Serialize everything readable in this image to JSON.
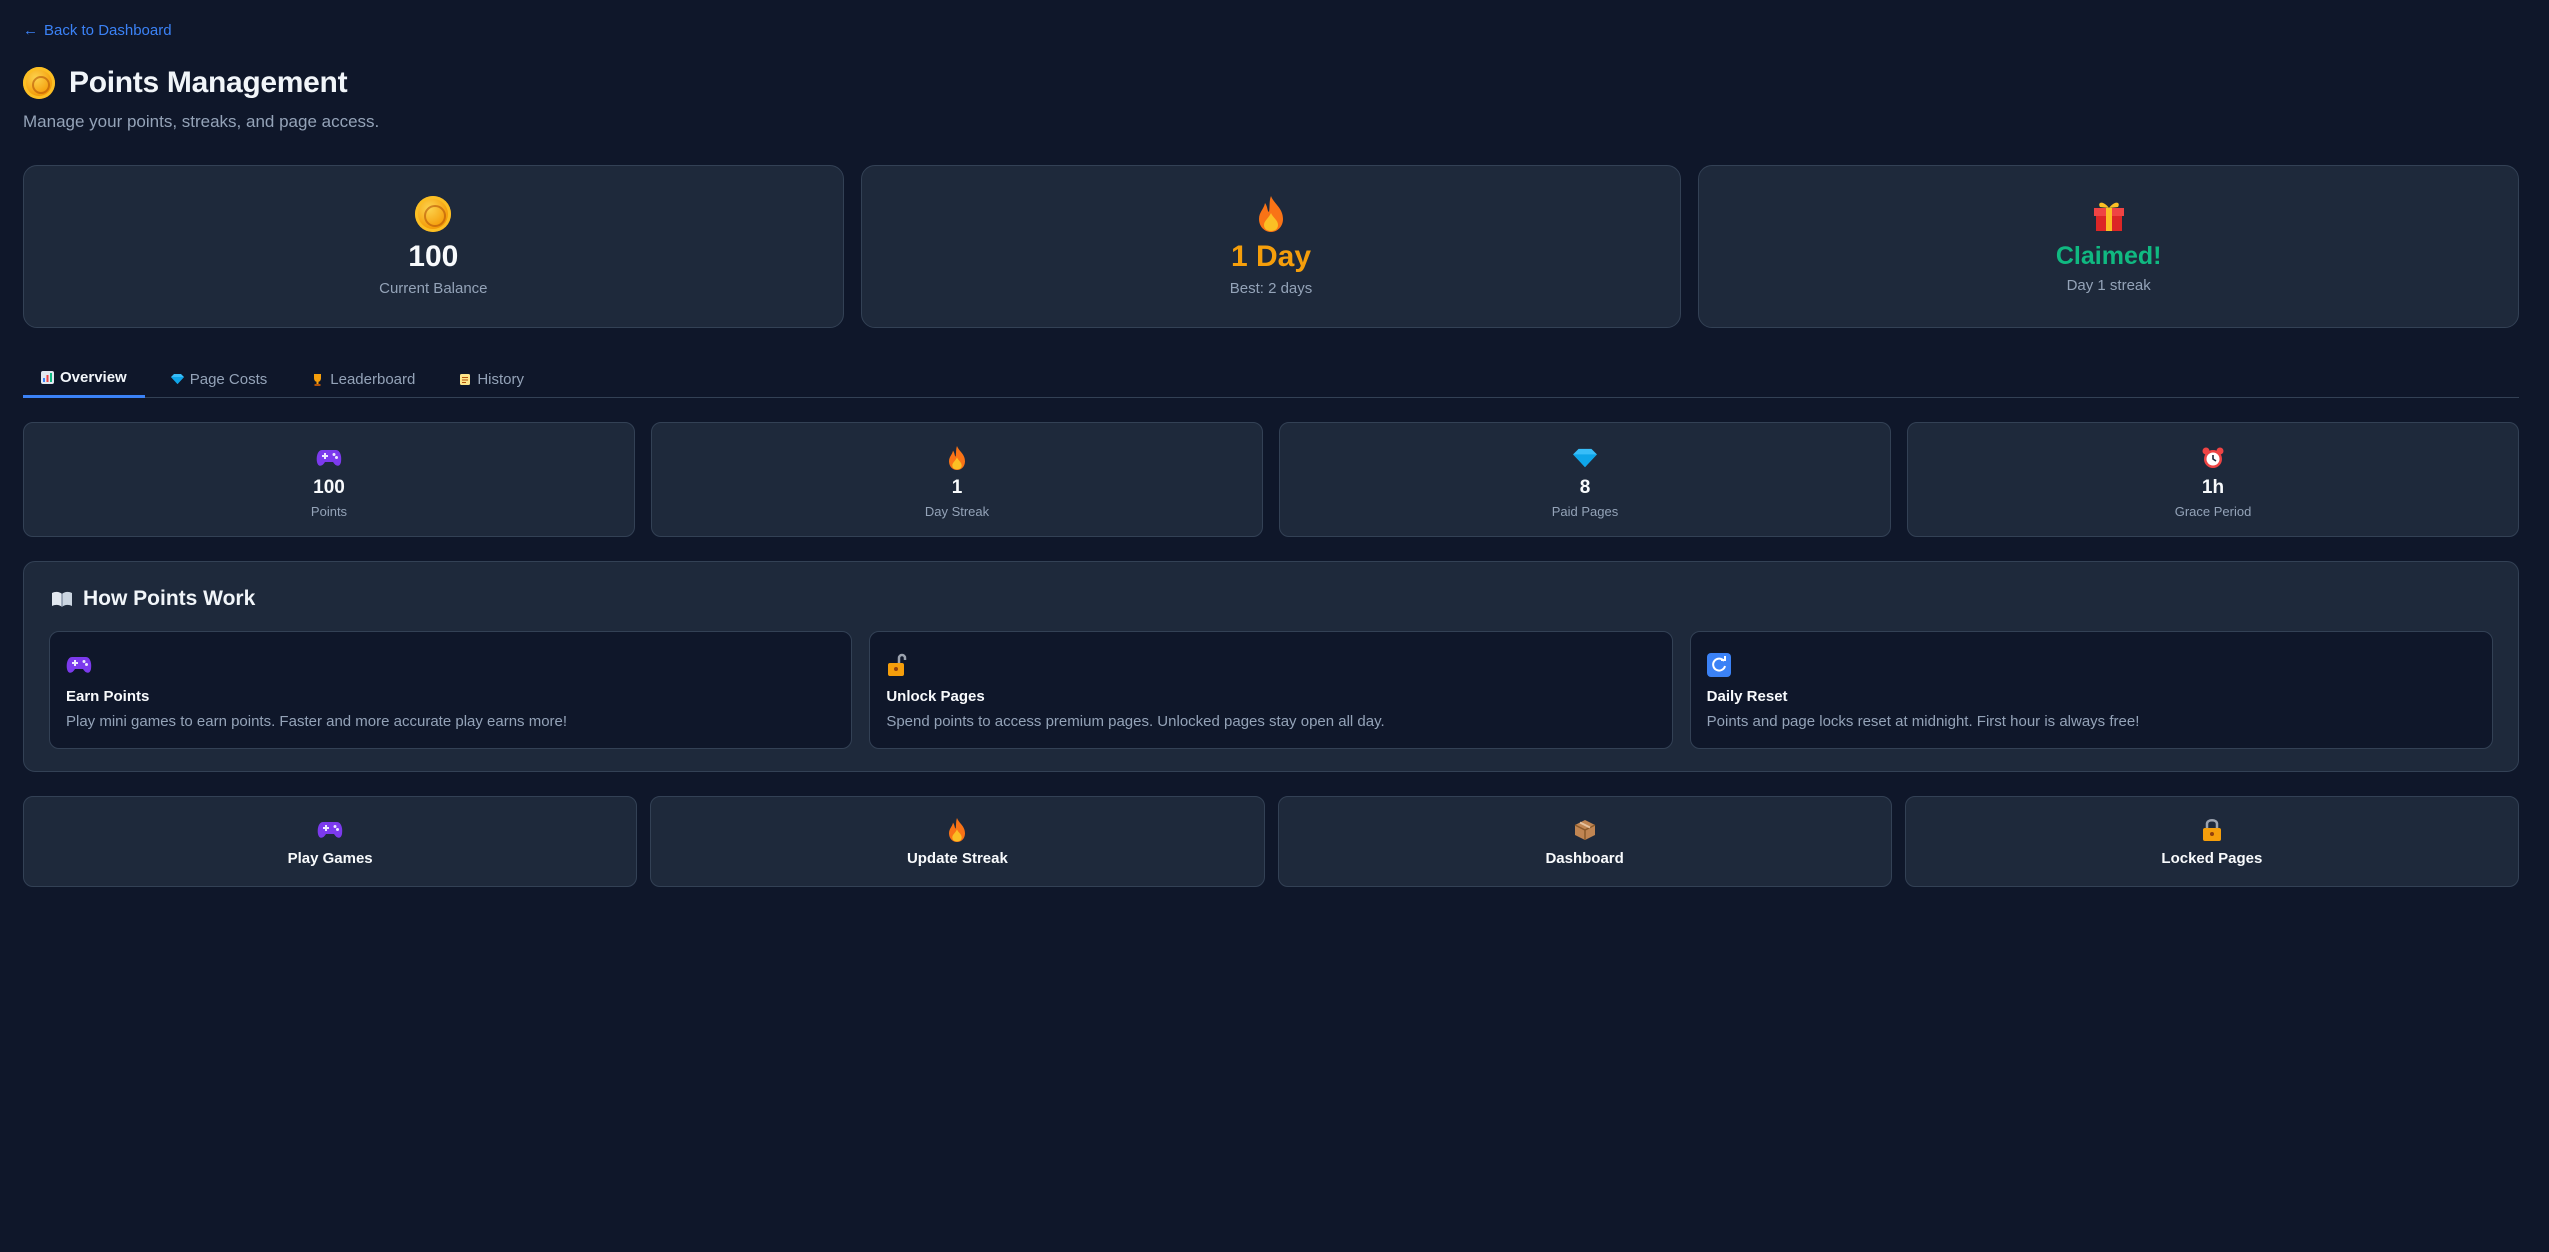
{
  "nav": {
    "back_label": "Back to Dashboard",
    "back_icon": "arrow-left-icon"
  },
  "header": {
    "title": "Points Management",
    "subtitle": "Manage your points, streaks, and page access.",
    "icon": "coin-icon"
  },
  "stats": [
    {
      "icon": "coin-icon",
      "value": "100",
      "label": "Current Balance",
      "color": "#f8fafc"
    },
    {
      "icon": "fire-icon",
      "value": "1 Day",
      "label": "Best: 2 days",
      "color": "#f59e0b"
    },
    {
      "icon": "gift-icon",
      "value": "Claimed!",
      "label": "Day 1 streak",
      "color": "#10b981"
    }
  ],
  "tabs": [
    {
      "icon": "chart-icon",
      "label": "Overview",
      "active": true
    },
    {
      "icon": "gem-icon",
      "label": "Page Costs",
      "active": false
    },
    {
      "icon": "trophy-icon",
      "label": "Leaderboard",
      "active": false
    },
    {
      "icon": "scroll-icon",
      "label": "History",
      "active": false
    }
  ],
  "overview": [
    {
      "icon": "gamepad-icon",
      "value": "100",
      "label": "Points"
    },
    {
      "icon": "fire-icon",
      "value": "1",
      "label": "Day Streak"
    },
    {
      "icon": "gem-icon",
      "value": "8",
      "label": "Paid Pages"
    },
    {
      "icon": "alarm-clock-icon",
      "value": "1h",
      "label": "Grace Period"
    }
  ],
  "how": {
    "title": "How Points Work",
    "icon": "book-icon",
    "cards": [
      {
        "icon": "gamepad-icon",
        "title": "Earn Points",
        "desc": "Play mini games to earn points. Faster and more accurate play earns more!"
      },
      {
        "icon": "unlock-icon",
        "title": "Unlock Pages",
        "desc": "Spend points to access premium pages. Unlocked pages stay open all day."
      },
      {
        "icon": "refresh-icon",
        "title": "Daily Reset",
        "desc": "Points and page locks reset at midnight. First hour is always free!"
      }
    ]
  },
  "actions": [
    {
      "icon": "gamepad-icon",
      "label": "Play Games"
    },
    {
      "icon": "fire-icon",
      "label": "Update Streak"
    },
    {
      "icon": "package-icon",
      "label": "Dashboard"
    },
    {
      "icon": "lock-icon",
      "label": "Locked Pages"
    }
  ],
  "colors": {
    "background": "#0f172a",
    "card": "#1e293b",
    "border": "#334155",
    "accent": "#3b82f6",
    "streak": "#f59e0b",
    "claimed": "#10b981"
  }
}
